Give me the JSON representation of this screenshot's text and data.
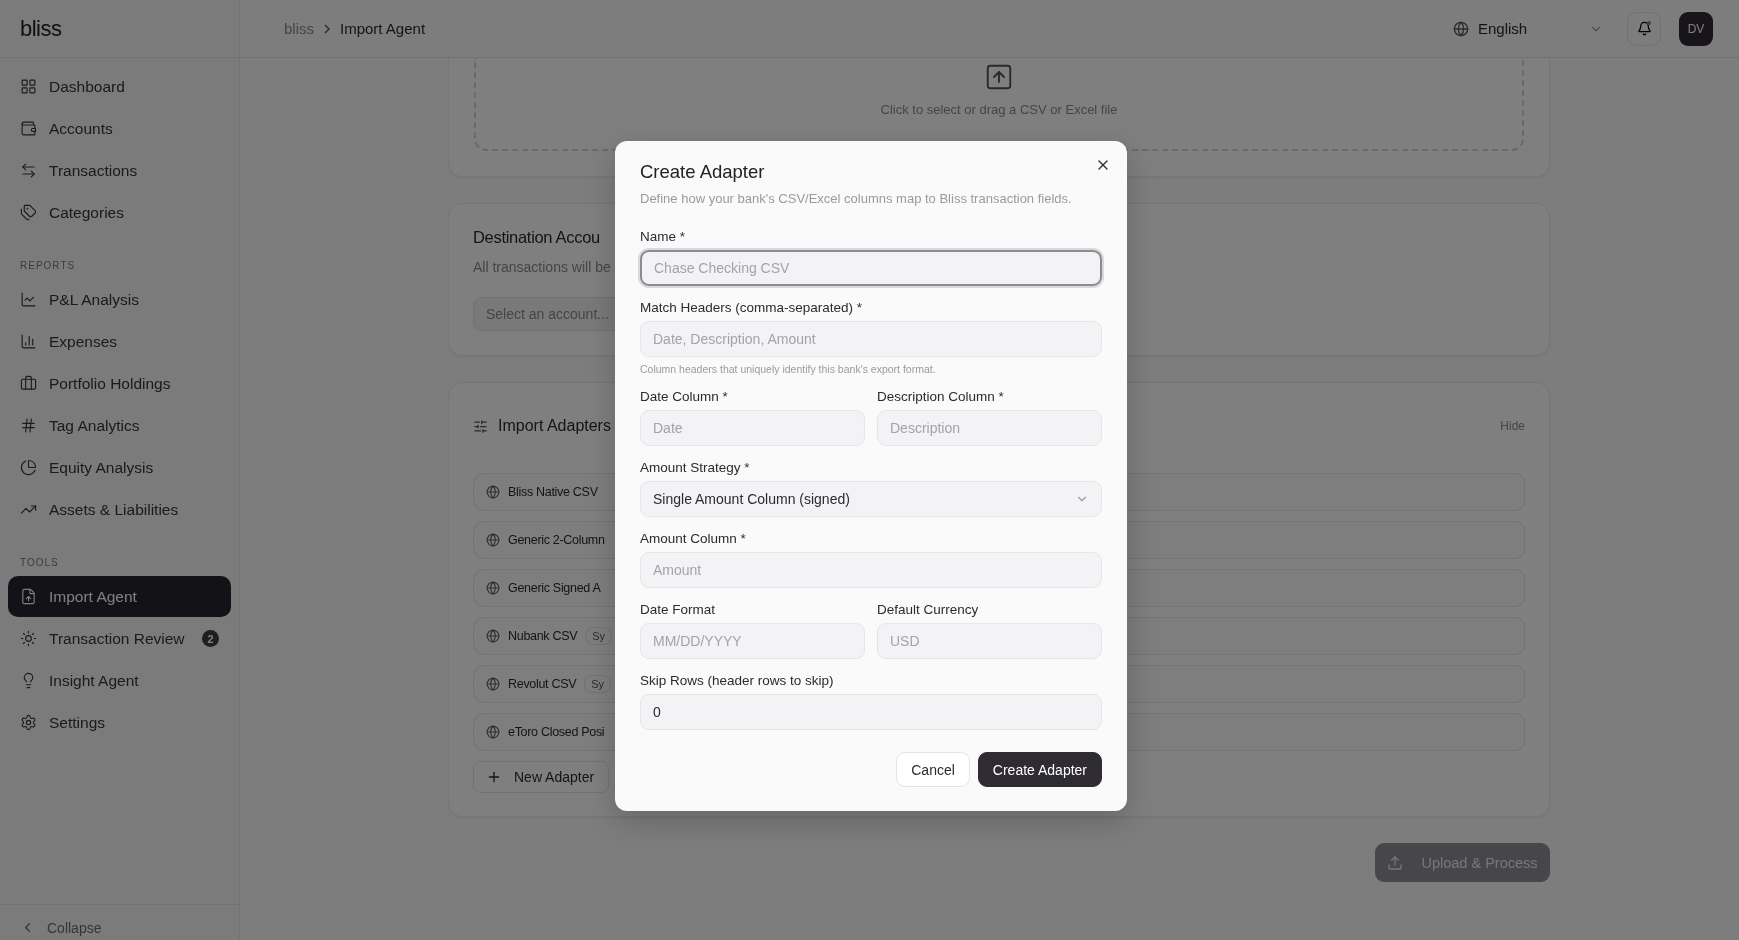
{
  "sidebar": {
    "logo": "bliss",
    "sections": [
      {
        "items": [
          {
            "label": "Dashboard",
            "selected": false
          },
          {
            "label": "Accounts",
            "selected": false
          },
          {
            "label": "Transactions",
            "selected": false
          },
          {
            "label": "Categories",
            "selected": false
          }
        ]
      },
      {
        "heading": "REPORTS",
        "items": [
          {
            "label": "P&L Analysis",
            "selected": false
          },
          {
            "label": "Expenses",
            "selected": false
          },
          {
            "label": "Portfolio Holdings",
            "selected": false
          },
          {
            "label": "Tag Analytics",
            "selected": false
          },
          {
            "label": "Equity Analysis",
            "selected": false
          },
          {
            "label": "Assets & Liabilities",
            "selected": false
          }
        ]
      },
      {
        "heading": "TOOLS",
        "items": [
          {
            "label": "Import Agent",
            "selected": true
          },
          {
            "label": "Transaction Review",
            "selected": false,
            "badge": "2"
          },
          {
            "label": "Insight Agent",
            "selected": false
          },
          {
            "label": "Settings",
            "selected": false
          }
        ]
      }
    ],
    "collapse": "Collapse"
  },
  "header": {
    "breadcrumb": [
      "bliss",
      "Import Agent"
    ],
    "language": "English",
    "unread": true,
    "avatar": "DV"
  },
  "upload": {
    "hint": "Click to select or drag a CSV or Excel file"
  },
  "destination": {
    "title": "Destination Accou",
    "subtitle": "All transactions will be",
    "placeholder": "Select an account..."
  },
  "adapters": {
    "title": "Import Adapters",
    "hide": "Hide",
    "items": [
      {
        "name": "Bliss Native CSV"
      },
      {
        "name": "Generic 2-Column"
      },
      {
        "name": "Generic Signed A"
      },
      {
        "name": "Nubank CSV",
        "badge": "Sy"
      },
      {
        "name": "Revolut CSV",
        "badge": "Sy"
      },
      {
        "name": "eToro Closed Posi"
      }
    ],
    "new_button": "New Adapter"
  },
  "submit": "Upload & Process",
  "dialog": {
    "title": "Create Adapter",
    "description": "Define how your bank's CSV/Excel columns map to Bliss transaction fields.",
    "rows": [
      [
        {
          "kind": "text",
          "label": "Name *",
          "placeholder": "Chase Checking CSV",
          "focused": true
        }
      ],
      [
        {
          "kind": "text",
          "label": "Match Headers (comma-separated) *",
          "placeholder": "Date, Description, Amount",
          "hint": "Column headers that uniquely identify this bank's export format.",
          "focused": false
        }
      ],
      [
        {
          "kind": "text",
          "label": "Date Column *",
          "placeholder": "Date",
          "focused": false
        },
        {
          "kind": "text",
          "label": "Description Column *",
          "placeholder": "Description",
          "focused": false
        }
      ],
      [
        {
          "kind": "select",
          "label": "Amount Strategy *",
          "value": "Single Amount Column (signed)",
          "focused": false
        }
      ],
      [
        {
          "kind": "text",
          "label": "Amount Column *",
          "placeholder": "Amount",
          "focused": false
        }
      ],
      [
        {
          "kind": "text",
          "label": "Date Format",
          "placeholder": "MM/DD/YYYY",
          "focused": false
        },
        {
          "kind": "text",
          "label": "Default Currency",
          "placeholder": "USD",
          "focused": false
        }
      ],
      [
        {
          "kind": "text",
          "label": "Skip Rows (header rows to skip)",
          "value": "0",
          "focused": false
        }
      ]
    ],
    "cancel": "Cancel",
    "confirm": "Create Adapter"
  }
}
